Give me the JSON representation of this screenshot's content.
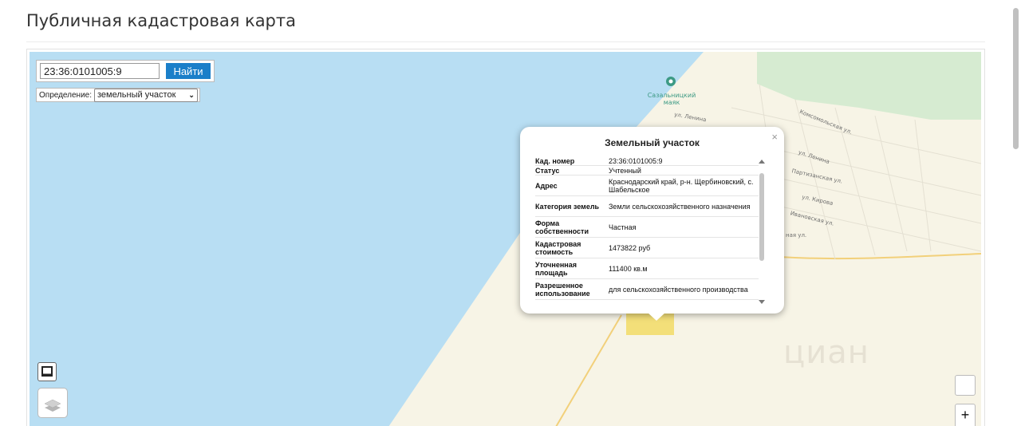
{
  "page": {
    "title": "Публичная кадастровая карта"
  },
  "search": {
    "value": "23:36:0101005:9",
    "button_label": "Найти"
  },
  "definition": {
    "label": "Определение:",
    "selected": "земельный участок"
  },
  "map_labels": {
    "poi": "Сазальницкий маяк",
    "streets": [
      "ул. Ленина",
      "Комсомольская ул.",
      "ул. Ленина",
      "Партизанская ул.",
      "ул. Кирова",
      "Ивановская ул.",
      "ная ул."
    ]
  },
  "watermark": "циан",
  "popup": {
    "title": "Земельный участок",
    "close_label": "×",
    "rows": [
      {
        "key": "Кад. номер",
        "value": "23:36:0101005:9"
      },
      {
        "key": "Статус",
        "value": "Учтенный"
      },
      {
        "key": "Адрес",
        "value": "Краснодарский край, р-н. Щербиновский, с. Шабельское"
      },
      {
        "key": "Категория земель",
        "value": "Земли сельскохозяйственного назначения"
      },
      {
        "key": "Форма собственности",
        "value": "Частная"
      },
      {
        "key": "Кадастровая стоимость",
        "value": "1473822 руб"
      },
      {
        "key": "Уточненная площадь",
        "value": "111400 кв.м"
      },
      {
        "key": "Разрешенное использование",
        "value": "для сельскохозяйственного производства"
      }
    ]
  },
  "controls": {
    "zoom_in": "+"
  },
  "colors": {
    "water": "#b8def3",
    "land": "#f7f4e6",
    "parcel": "#f3df79",
    "green": "#d6ebd1",
    "accent": "#1b7fc9"
  }
}
